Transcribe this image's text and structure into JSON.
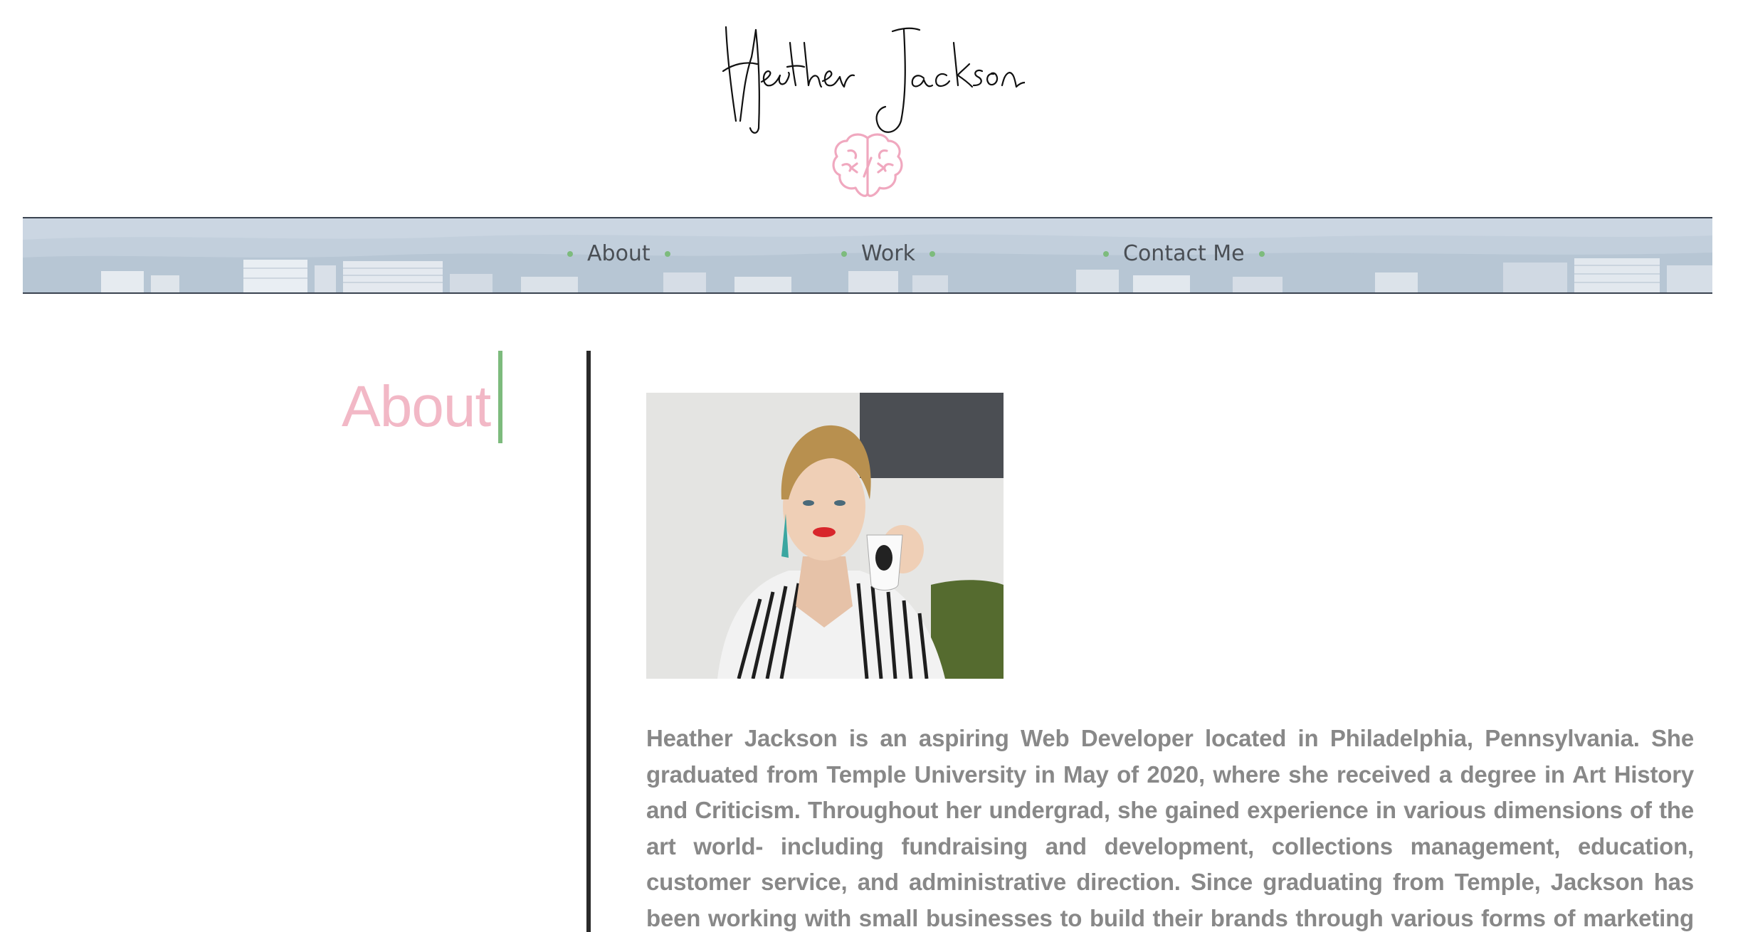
{
  "header": {
    "signature_text": "Heather Jackson"
  },
  "nav": {
    "items": [
      {
        "label": "About"
      },
      {
        "label": "Work"
      },
      {
        "label": "Contact Me"
      }
    ],
    "accent_color": "#7dbb7d"
  },
  "about": {
    "heading": "About",
    "heading_color": "#f2b8c6",
    "bio": "Heather Jackson is an aspiring Web Developer located in Philadelphia, Pennsylvania. She graduated from Temple University in May of 2020, where she received a degree in Art History and Criticism. Throughout her undergrad, she gained experience in various dimensions of the art world- including fundraising and development, collections management, education, customer service, and administrative direction. Since graduating from Temple, Jackson has been working with small businesses to build their brands through various forms of marketing and gain virtual foot traffic by means of website design and"
  },
  "icons": {
    "logo": "brain-icon"
  }
}
